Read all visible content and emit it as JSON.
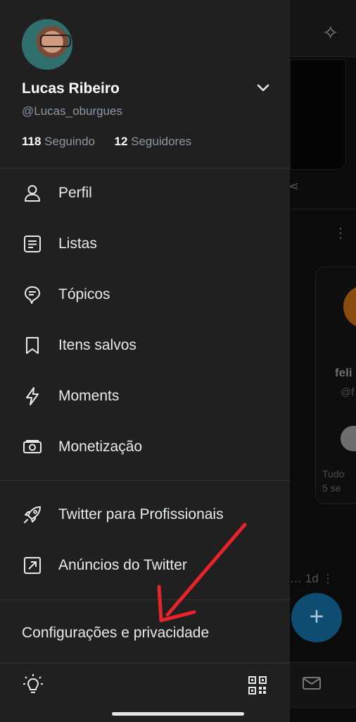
{
  "profile": {
    "name": "Lucas Ribeiro",
    "handle": "@Lucas_oburgues",
    "following_count": "118",
    "following_label": "Seguindo",
    "followers_count": "12",
    "followers_label": "Seguidores"
  },
  "menu": {
    "items": [
      {
        "label": "Perfil",
        "icon": "person-icon"
      },
      {
        "label": "Listas",
        "icon": "list-icon"
      },
      {
        "label": "Tópicos",
        "icon": "topics-icon"
      },
      {
        "label": "Itens salvos",
        "icon": "bookmark-icon"
      },
      {
        "label": "Moments",
        "icon": "lightning-icon"
      },
      {
        "label": "Monetização",
        "icon": "money-icon"
      }
    ],
    "pro_items": [
      {
        "label": "Twitter para Profissionais",
        "icon": "rocket-icon"
      },
      {
        "label": "Anúncios do Twitter",
        "icon": "external-arrow-icon"
      }
    ],
    "settings_label": "Configurações e privacidade"
  },
  "background_feed": {
    "name_partial": "feli",
    "handle_partial": "@f",
    "meta_line1": "Tudo",
    "meta_line2": "5 se",
    "time_partial": "1d",
    "fab_symbol": "+"
  },
  "colors": {
    "drawer_bg": "#202020",
    "text_primary": "#e7e9ea",
    "text_secondary": "#8b98a5",
    "annotation_arrow": "#e8232a",
    "fab": "#0f4d73"
  }
}
